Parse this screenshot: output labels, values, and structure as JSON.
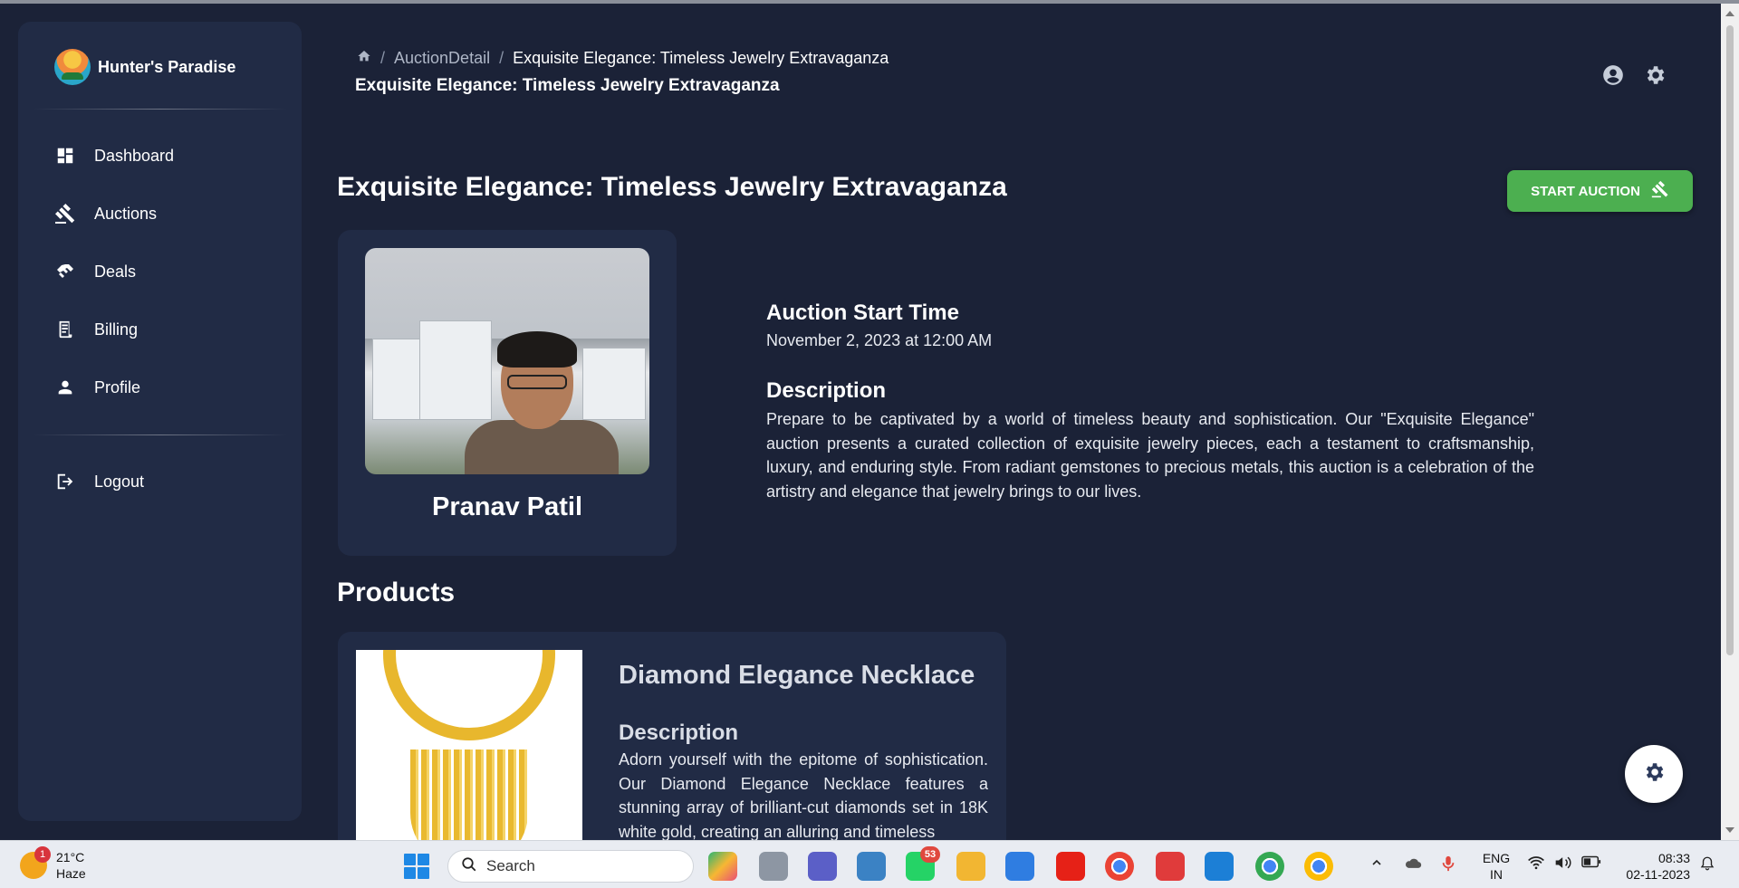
{
  "sidebar": {
    "brand": "Hunter's Paradise",
    "items": [
      {
        "label": "Dashboard",
        "icon": "dashboard-icon"
      },
      {
        "label": "Auctions",
        "icon": "gavel-icon"
      },
      {
        "label": "Deals",
        "icon": "handshake-icon"
      },
      {
        "label": "Billing",
        "icon": "receipt-icon"
      },
      {
        "label": "Profile",
        "icon": "person-icon"
      }
    ],
    "logout": {
      "label": "Logout",
      "icon": "logout-icon"
    }
  },
  "header": {
    "breadcrumb": [
      "AuctionDetail",
      "Exquisite Elegance: Timeless Jewelry Extravaganza"
    ],
    "subtitle": "Exquisite Elegance: Timeless Jewelry Extravaganza"
  },
  "auction": {
    "title": "Exquisite Elegance: Timeless Jewelry Extravaganza",
    "start_button": "START AUCTION",
    "seller_name": "Pranav Patil",
    "start_time_label": "Auction Start Time",
    "start_time_value": "November 2, 2023 at 12:00 AM",
    "description_label": "Description",
    "description": "Prepare to be captivated by a world of timeless beauty and sophistication. Our \"Exquisite Elegance\" auction presents a curated collection of exquisite jewelry pieces, each a testament to craftsmanship, luxury, and enduring style. From radiant gemstones to precious metals, this auction is a celebration of the artistry and elegance that jewelry brings to our lives."
  },
  "products": {
    "section_title": "Products",
    "items": [
      {
        "title": "Diamond Elegance Necklace",
        "description_label": "Description",
        "description": "Adorn yourself with the epitome of sophistication. Our Diamond Elegance Necklace features a stunning array of brilliant-cut diamonds set in 18K white gold, creating an alluring and timeless"
      }
    ]
  },
  "taskbar": {
    "weather_temp": "21°C",
    "weather_desc": "Haze",
    "weather_badge": "1",
    "search_placeholder": "Search",
    "whatsapp_badge": "53",
    "lang_top": "ENG",
    "lang_bottom": "IN",
    "time": "08:33",
    "date": "02-11-2023"
  },
  "colors": {
    "background": "#1b2237",
    "card": "#212b45",
    "accent_green": "#4caf50"
  }
}
